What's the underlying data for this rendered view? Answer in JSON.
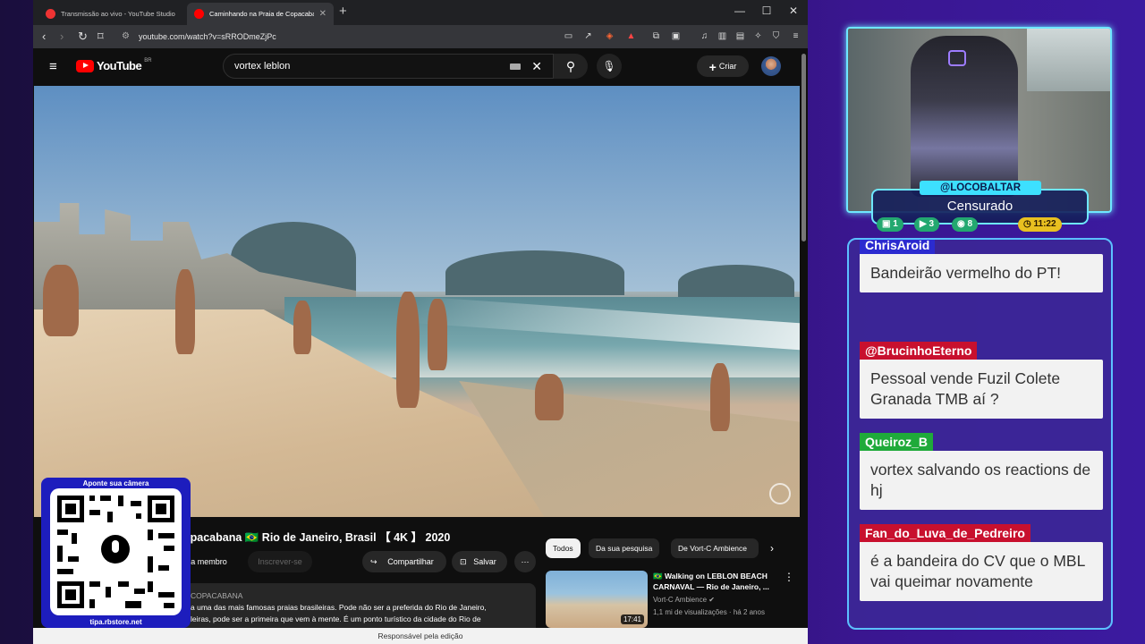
{
  "browser": {
    "tabs": [
      {
        "label": "Transmissão ao vivo - YouTube Studio",
        "active": false
      },
      {
        "label": "Caminhando na Praia de Copacabana",
        "active": true
      }
    ],
    "url": "youtube.com/watch?v=sRRODmeZjPc"
  },
  "youtube": {
    "logo_text": "YouTube",
    "logo_region": "BR",
    "search_value": "vortex leblon",
    "create_label": "Criar",
    "video_title": "opacabana 🇧🇷 Rio de Janeiro, Brasil 【 4K 】 2020",
    "join_label": "eja membro",
    "subscribe_label": "Inscrever-se",
    "share_label": "Compartilhar",
    "save_label": "Salvar",
    "desc_channel": "COPACABANA",
    "desc_line1": "a uma das mais famosas praias brasileiras. Pode não ser a preferida do Rio de Janeiro,",
    "desc_line2": "leiras, pode ser a primeira que vem à mente. É um ponto turístico da cidade do Rio de",
    "chips": [
      "Todos",
      "Da sua pesquisa",
      "De Vort-C Ambience"
    ],
    "rec": {
      "title": "🇧🇷 Walking on LEBLON BEACH CARNAVAL — Rio de Janeiro, ...",
      "channel": "Vort-C Ambience ✔",
      "meta": "1,1 mi de visualizações · há 2 anos",
      "duration": "17:41"
    },
    "edit_bar": "Responsável pela edição"
  },
  "qr": {
    "top_label": "Aponte sua câmera",
    "bottom_label": "tipa.rbstore.net"
  },
  "stream": {
    "handle": "@LOCOBALTAR",
    "status": "Censurado",
    "stats": [
      "1",
      "3",
      "8",
      "11:22"
    ]
  },
  "chat": [
    {
      "user": "ChrisAroid",
      "text": "Bandeirão vermelho do PT!",
      "color": "#2b2bd0"
    },
    {
      "user": "@BrucinhoEterno",
      "text": "Pessoal vende Fuzil Colete Granada TMB aí ?",
      "color": "#c8102e"
    },
    {
      "user": "Queiroz_B",
      "text": "vortex salvando os reactions de hj",
      "color": "#1faa3a"
    },
    {
      "user": "Fan_do_Luva_de_Pedreiro",
      "text": "é a bandeira do CV que o MBL vai queimar novamente",
      "color": "#c8102e"
    }
  ],
  "colors": {
    "accent": "#6ee7ff",
    "youtube_red": "#ff0000"
  }
}
